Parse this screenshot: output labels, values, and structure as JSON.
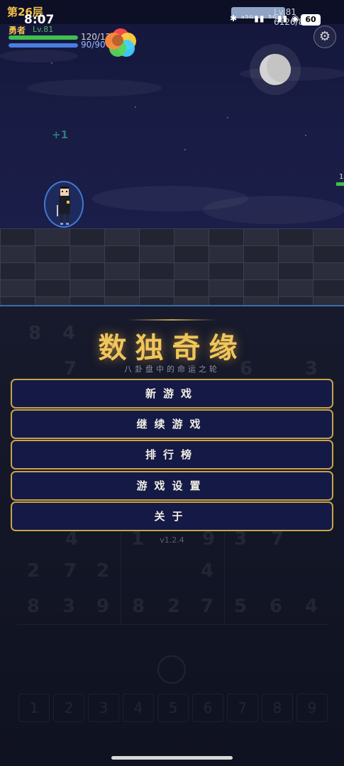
{
  "status": {
    "floor": "第26层",
    "time": "8:07",
    "level_exp": "Lv.81 6126/8100",
    "signal_icons": "✱ ᵃ⁵ᴳ▮▮ ⁵ᴳ▮▮ ◉",
    "battery": "60"
  },
  "hero": {
    "name": "勇者",
    "level": "Lv.81",
    "hp_text": "120/120",
    "mp_text": "90/90",
    "hp_fraction": 1.0,
    "mp_fraction": 1.0,
    "gain_popup": "+1"
  },
  "enemy": {
    "count_text": "1"
  },
  "icons": {
    "settings": "gear-icon",
    "moon": "moon-icon",
    "color_orb": "color-orb-icon"
  },
  "colors": {
    "gold": "#c9a24a",
    "title_gold": "#f0c55a",
    "button_bg": "#141a45",
    "hp_green": "#3fbf4f",
    "mp_blue": "#4a7ee0"
  },
  "menu": {
    "title": "数独奇缘",
    "subtitle": "八卦盘中的命运之轮",
    "buttons": [
      "新游戏",
      "继续游戏",
      "排行榜",
      "游戏设置",
      "关于"
    ],
    "version": "v1.2.4"
  },
  "background_board": {
    "digits": [
      "8",
      "4",
      "7",
      "6",
      "3",
      "4",
      "1",
      "9",
      "3",
      "7",
      "2",
      "7",
      "2",
      "4",
      "8",
      "3",
      "9",
      "8",
      "2",
      "7",
      "5",
      "6",
      "4"
    ],
    "keypad": [
      "1",
      "2",
      "3",
      "4",
      "5",
      "6",
      "7",
      "8",
      "9"
    ]
  }
}
